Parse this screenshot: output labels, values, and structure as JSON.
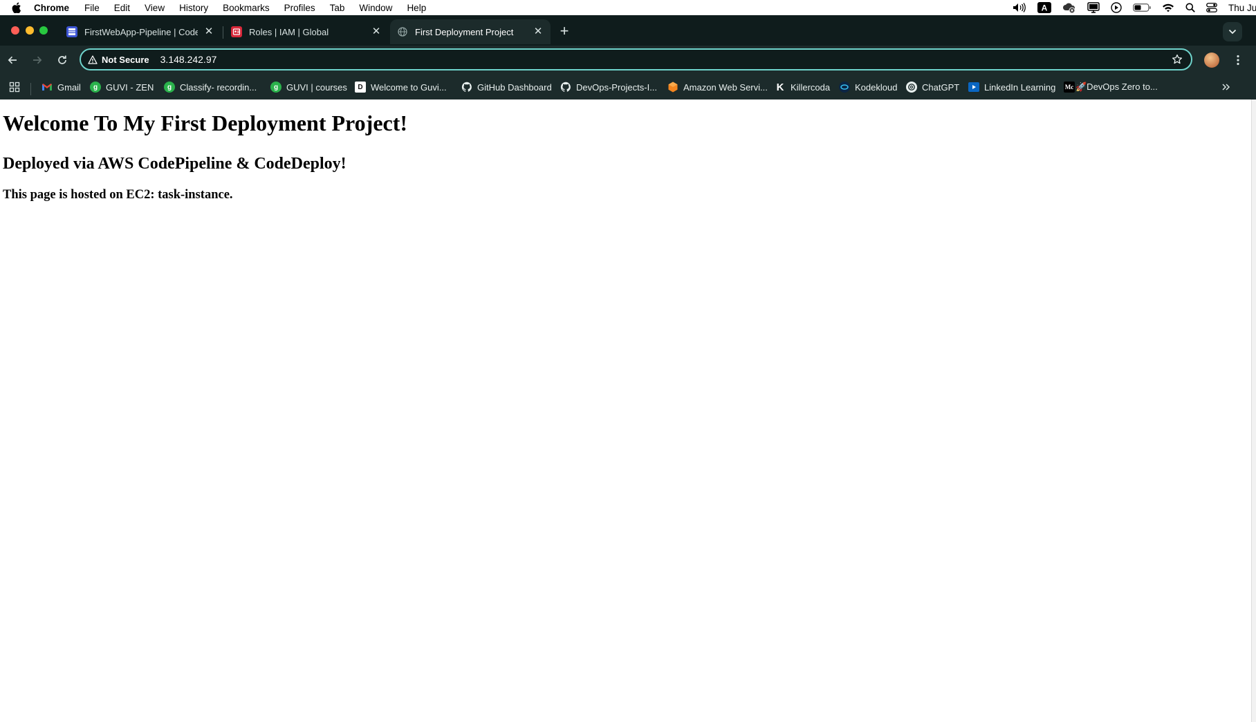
{
  "menubar": {
    "app": "Chrome",
    "items": [
      "File",
      "Edit",
      "View",
      "History",
      "Bookmarks",
      "Profiles",
      "Tab",
      "Window",
      "Help"
    ],
    "clock": "Thu Jun"
  },
  "tabs": [
    {
      "title": "FirstWebApp-Pipeline | CodePipeline",
      "icon": "codepipeline-icon",
      "color": "#3d55d4"
    },
    {
      "title": "Roles | IAM | Global",
      "icon": "iam-icon",
      "color": "#d8283a"
    },
    {
      "title": "First Deployment Project",
      "icon": "globe-icon",
      "active": true
    }
  ],
  "omnibox": {
    "security": "Not Secure",
    "url": "3.148.242.97"
  },
  "bookmarks": [
    {
      "label": "Gmail",
      "icon": "gmail-icon"
    },
    {
      "label": "GUVI - ZEN",
      "icon": "guvi-icon"
    },
    {
      "label": "Classify- recordin...",
      "icon": "guvi-icon"
    },
    {
      "label": "GUVI | courses",
      "icon": "guvi-icon"
    },
    {
      "label": "Welcome to Guvi...",
      "icon": "d-icon"
    },
    {
      "label": "GitHub Dashboard",
      "icon": "github-icon"
    },
    {
      "label": "DevOps-Projects-I...",
      "icon": "github-icon"
    },
    {
      "label": "Amazon Web Servi...",
      "icon": "aws-icon"
    },
    {
      "label": "Killercoda",
      "icon": "killercoda-icon"
    },
    {
      "label": "Kodekloud",
      "icon": "kodekloud-icon"
    },
    {
      "label": "ChatGPT",
      "icon": "chatgpt-icon"
    },
    {
      "label": "LinkedIn Learning",
      "icon": "linkedin-learning-icon"
    },
    {
      "label": "🚀DevOps Zero to...",
      "icon": "medium-icon"
    }
  ],
  "page": {
    "heading": "Welcome To My First Deployment Project!",
    "subheading": "Deployed via AWS CodePipeline & CodeDeploy!",
    "hosted": "This page is hosted on EC2: task-instance."
  },
  "colors": {
    "accent": "#6fd4cc",
    "chrome_bg": "#1c2b2b",
    "tabstrip_bg": "#0f1c1c"
  }
}
